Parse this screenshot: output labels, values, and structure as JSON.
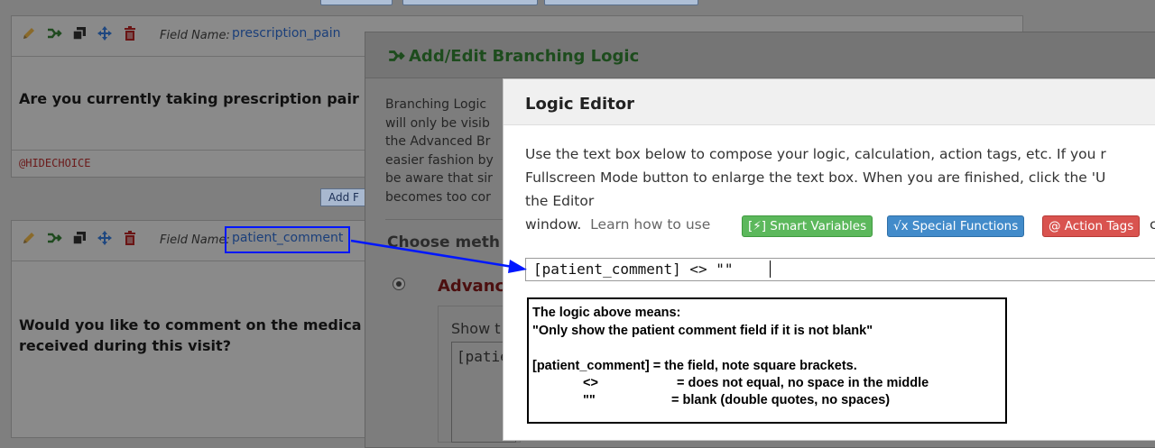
{
  "fields": [
    {
      "label": "Field Name:",
      "name": "prescription_pain",
      "question": "Are you currently taking prescription pair",
      "action_tag": "@HIDECHOICE"
    },
    {
      "label": "Field Name:",
      "name": "patient_comment",
      "question_line1": "Would you like to comment on the medica",
      "question_line2": "received during this visit?"
    }
  ],
  "add_field_label": "Add F",
  "branching_dialog": {
    "title": "Add/Edit Branching Logic",
    "intro_lines": [
      "Branching Logic",
      "will only be visib",
      "the Advanced Br",
      "easier fashion by",
      "be aware that sir",
      "becomes too cor"
    ],
    "choose_label": "Choose meth",
    "advanced_label": "Advanc",
    "show_label": "Show t",
    "textarea_value": "[patier"
  },
  "logic_editor": {
    "title": "Logic Editor",
    "instructions": [
      "Use the text box below to compose your logic, calculation, action tags, etc. If you r",
      "Fullscreen Mode button to enlarge the text box. When you are finished, click the 'U",
      "the Editor"
    ],
    "window_word": "window.",
    "learn_text": "Learn how to use",
    "buttons": [
      {
        "label": "[⚡] Smart Variables",
        "color": "#5cb85c"
      },
      {
        "label": "√x Special Functions",
        "color": "#428bca"
      },
      {
        "label": "@ Action Tags",
        "color": "#d9534f"
      }
    ],
    "trailing_text": "c",
    "logic_value": "[patient_comment] <> \"\""
  },
  "explanation": {
    "heading": "The logic above means:",
    "quote": "\"Only show the patient comment field if it is not blank\"",
    "line1": "[patient_comment] = the field, note square brackets.",
    "line2_sym": "<>",
    "line2_text": "= does not equal, no space in the middle",
    "line3_sym": "\"\"",
    "line3_text": "= blank (double quotes, no spaces)"
  },
  "colors": {
    "highlight": "#0017ff",
    "branch_title": "#1d4c1d"
  }
}
